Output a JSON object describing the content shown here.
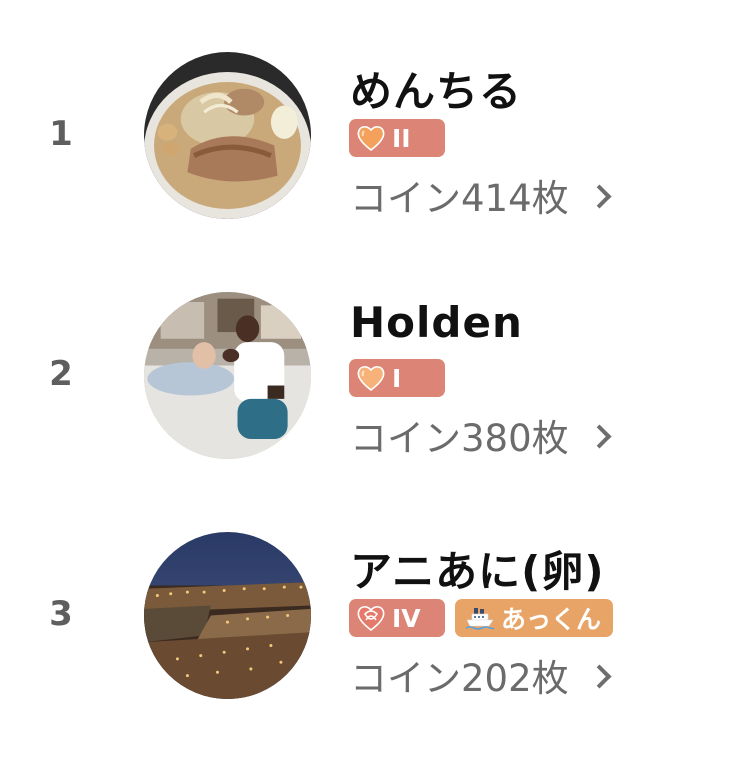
{
  "ranking": [
    {
      "rank": "1",
      "name": "めんちる",
      "badges": [
        {
          "icon": "orange-heart-icon",
          "text": "II",
          "color": "#dc8577"
        }
      ],
      "coins": "コイン414枚"
    },
    {
      "rank": "2",
      "name": "Holden",
      "badges": [
        {
          "icon": "orange-heart-icon",
          "text": "I",
          "color": "#dc8577"
        }
      ],
      "coins": "コイン380枚"
    },
    {
      "rank": "3",
      "name": "アニあに(卵)",
      "badges": [
        {
          "icon": "heart-knot-icon",
          "text": "IV",
          "color": "#dc8577"
        },
        {
          "icon": "ship-icon",
          "text": "あっくん",
          "color": "#e8a466"
        }
      ],
      "coins": "コイン202枚"
    }
  ]
}
